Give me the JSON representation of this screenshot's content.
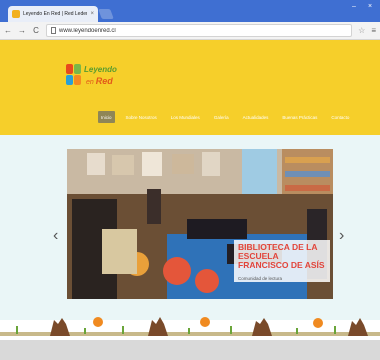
{
  "browser": {
    "tab_title": "Leyendo En Red | Red Leden",
    "tab_close": "×",
    "url": "www.leyendoenred.cl",
    "back": "←",
    "forward": "→",
    "reload": "C",
    "star": "☆",
    "menu": "≡",
    "minimize": "–",
    "close": "×"
  },
  "site": {
    "logo_line1": "Leyendo",
    "logo_line2_prefix": "en",
    "logo_line2": "Red",
    "nav": [
      "Inicio",
      "Sobre Nosotros",
      "Los Mundiales",
      "Galería",
      "Actualidades",
      "Buenas Prácticas",
      "Contacto"
    ],
    "slide": {
      "title": "BIBLIOTECA DE LA ESCUELA FRANCISCO DE ASÍS",
      "subtitle": "Comunidad de lectura"
    },
    "prev_arrow": "‹",
    "next_arrow": "›"
  },
  "colors": {
    "header": "#f6cf2a",
    "hero_bg": "#eaf6f7",
    "caption_title": "#e2443a",
    "tabbar": "#3f6fd2"
  }
}
